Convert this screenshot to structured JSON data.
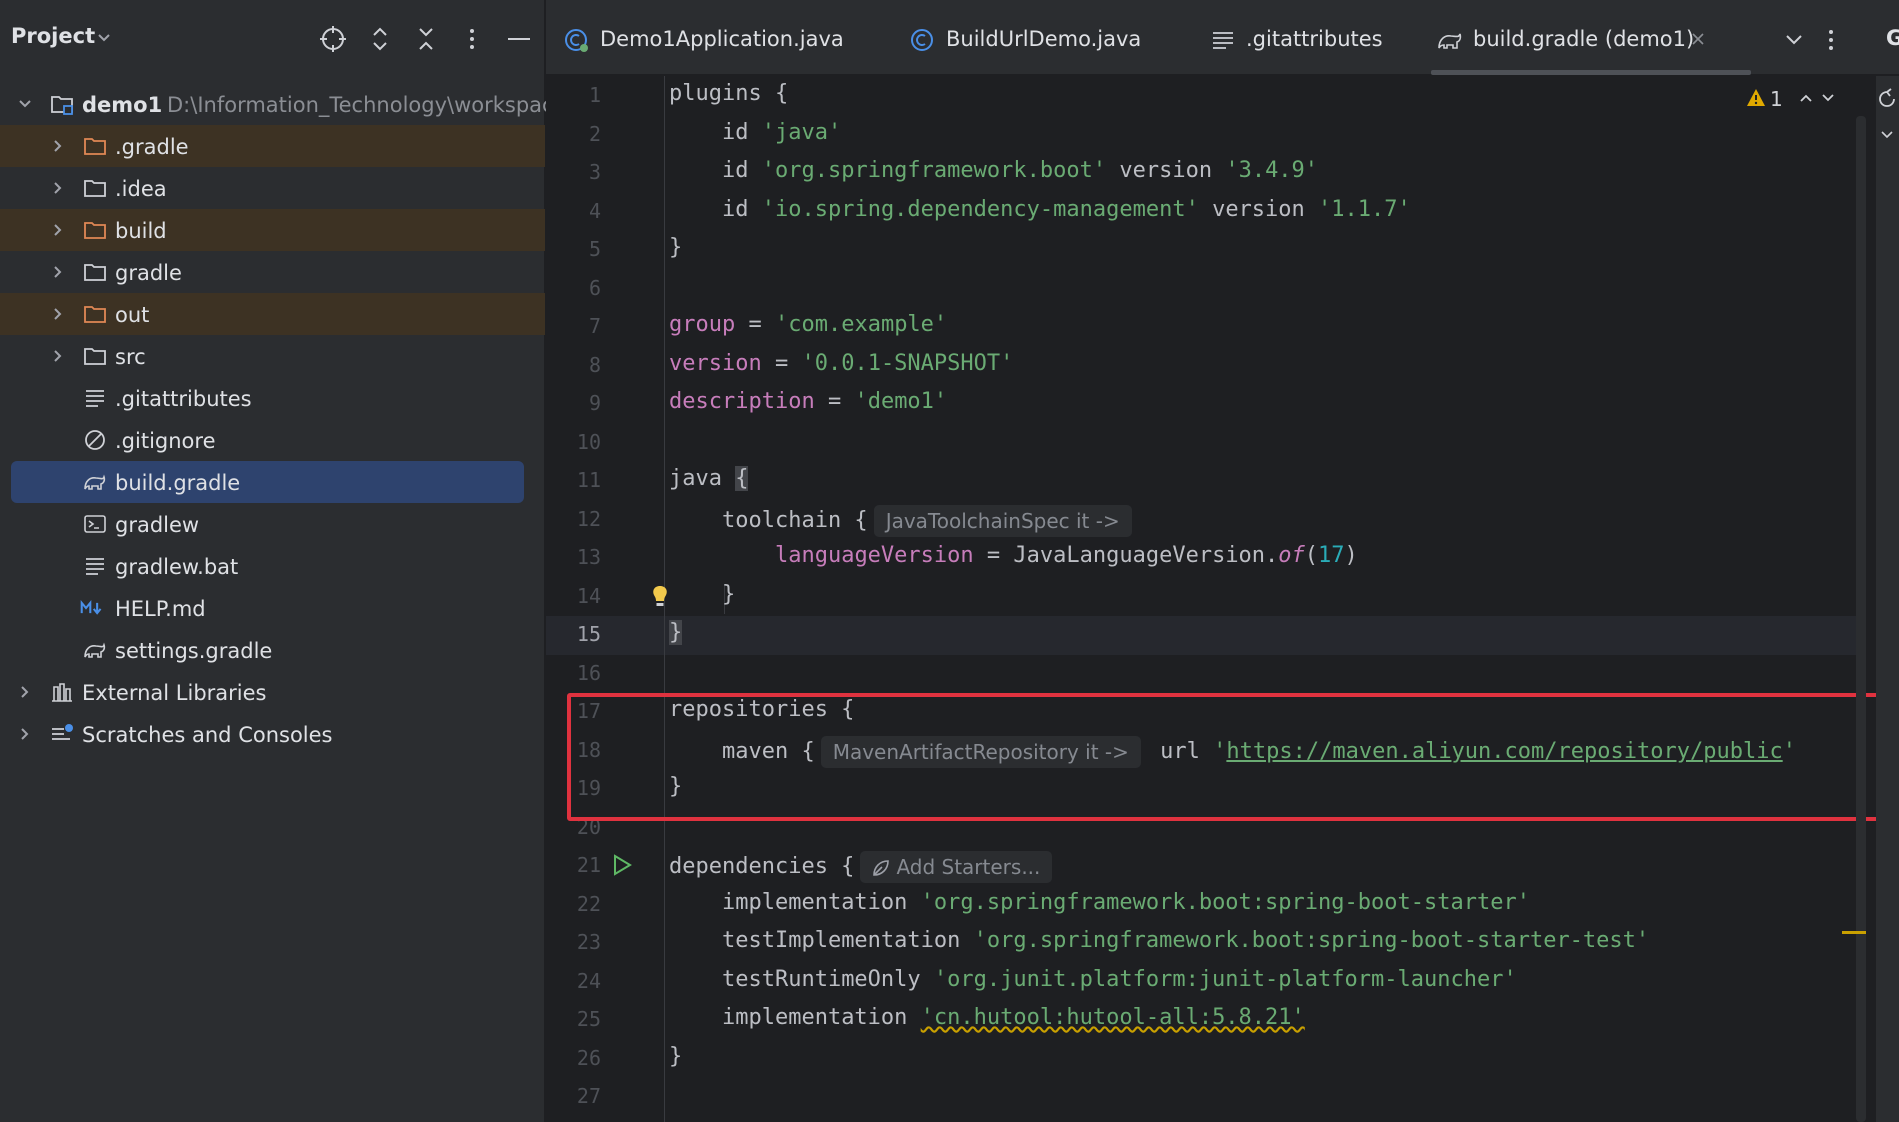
{
  "project_panel": {
    "title": "Project",
    "tree": [
      {
        "label": "demo1",
        "path": "D:\\Information_Technology\\workspac"
      },
      {
        "label": ".gradle"
      },
      {
        "label": ".idea"
      },
      {
        "label": "build"
      },
      {
        "label": "gradle"
      },
      {
        "label": "out"
      },
      {
        "label": "src"
      },
      {
        "label": ".gitattributes"
      },
      {
        "label": ".gitignore"
      },
      {
        "label": "build.gradle"
      },
      {
        "label": "gradlew"
      },
      {
        "label": "gradlew.bat"
      },
      {
        "label": "HELP.md"
      },
      {
        "label": "settings.gradle"
      },
      {
        "label": "External Libraries"
      },
      {
        "label": "Scratches and Consoles"
      }
    ]
  },
  "tabs": [
    {
      "label": "Demo1Application.java"
    },
    {
      "label": "BuildUrlDemo.java"
    },
    {
      "label": ".gitattributes"
    },
    {
      "label": "build.gradle (demo1)"
    }
  ],
  "right_strip": {
    "letter": "G"
  },
  "editor": {
    "warnings_count": "1",
    "line_numbers": [
      "1",
      "2",
      "3",
      "4",
      "5",
      "6",
      "7",
      "8",
      "9",
      "10",
      "11",
      "12",
      "13",
      "14",
      "15",
      "16",
      "17",
      "18",
      "19",
      "20",
      "21",
      "22",
      "23",
      "24",
      "25",
      "26",
      "27"
    ],
    "code": {
      "l1": "plugins {",
      "l2_kw": "id ",
      "l2_str": "'java'",
      "l3_kw": "id ",
      "l3_str": "'org.springframework.boot'",
      "l3_ver": " version ",
      "l3_str2": "'3.4.9'",
      "l4_kw": "id ",
      "l4_str": "'io.spring.dependency-management'",
      "l4_ver": " version ",
      "l4_str2": "'1.1.7'",
      "l5": "}",
      "l7_prop": "group",
      "l7_eq": " = ",
      "l7_str": "'com.example'",
      "l8_prop": "version",
      "l8_eq": " = ",
      "l8_str": "'0.0.1-SNAPSHOT'",
      "l9_prop": "description",
      "l9_eq": " = ",
      "l9_str": "'demo1'",
      "l11_kw": "java ",
      "l11_brace": "{",
      "l12_kw": "toolchain {",
      "l12_hint": "JavaToolchainSpec it ->",
      "l13_prop": "languageVersion",
      "l13_eq": " = JavaLanguageVersion.",
      "l13_of": "of",
      "l13_p1": "(",
      "l13_num": "17",
      "l13_p2": ")",
      "l14": "}",
      "l15": "}",
      "l17": "repositories {",
      "l18_kw": "maven {",
      "l18_hint": "MavenArtifactRepository it ->",
      "l18_url": " url ",
      "l18_q": "'",
      "l18_link": "https://maven.aliyun.com/repository/public",
      "l18_q2": "'",
      "l19": "}",
      "l21_kw": "dependencies {",
      "l21_hint": "Add Starters...",
      "l22_kw": "implementation ",
      "l22_str": "'org.springframework.boot:spring-boot-starter'",
      "l23_kw": "testImplementation ",
      "l23_str": "'org.springframework.boot:spring-boot-starter-test'",
      "l24_kw": "testRuntimeOnly ",
      "l24_str": "'org.junit.platform:junit-platform-launcher'",
      "l25_kw": "implementation ",
      "l25_str": "'cn.hutool:hutool-all:5.8.21'",
      "l26": "}"
    }
  },
  "colors": {
    "accent_selection": "#2e436e",
    "excluded_folder_bg": "#3d3223",
    "highlight_box": "#e0323f",
    "string": "#6aab73",
    "property": "#c77dbb",
    "number": "#2aacb8",
    "warning": "#c9a000"
  }
}
